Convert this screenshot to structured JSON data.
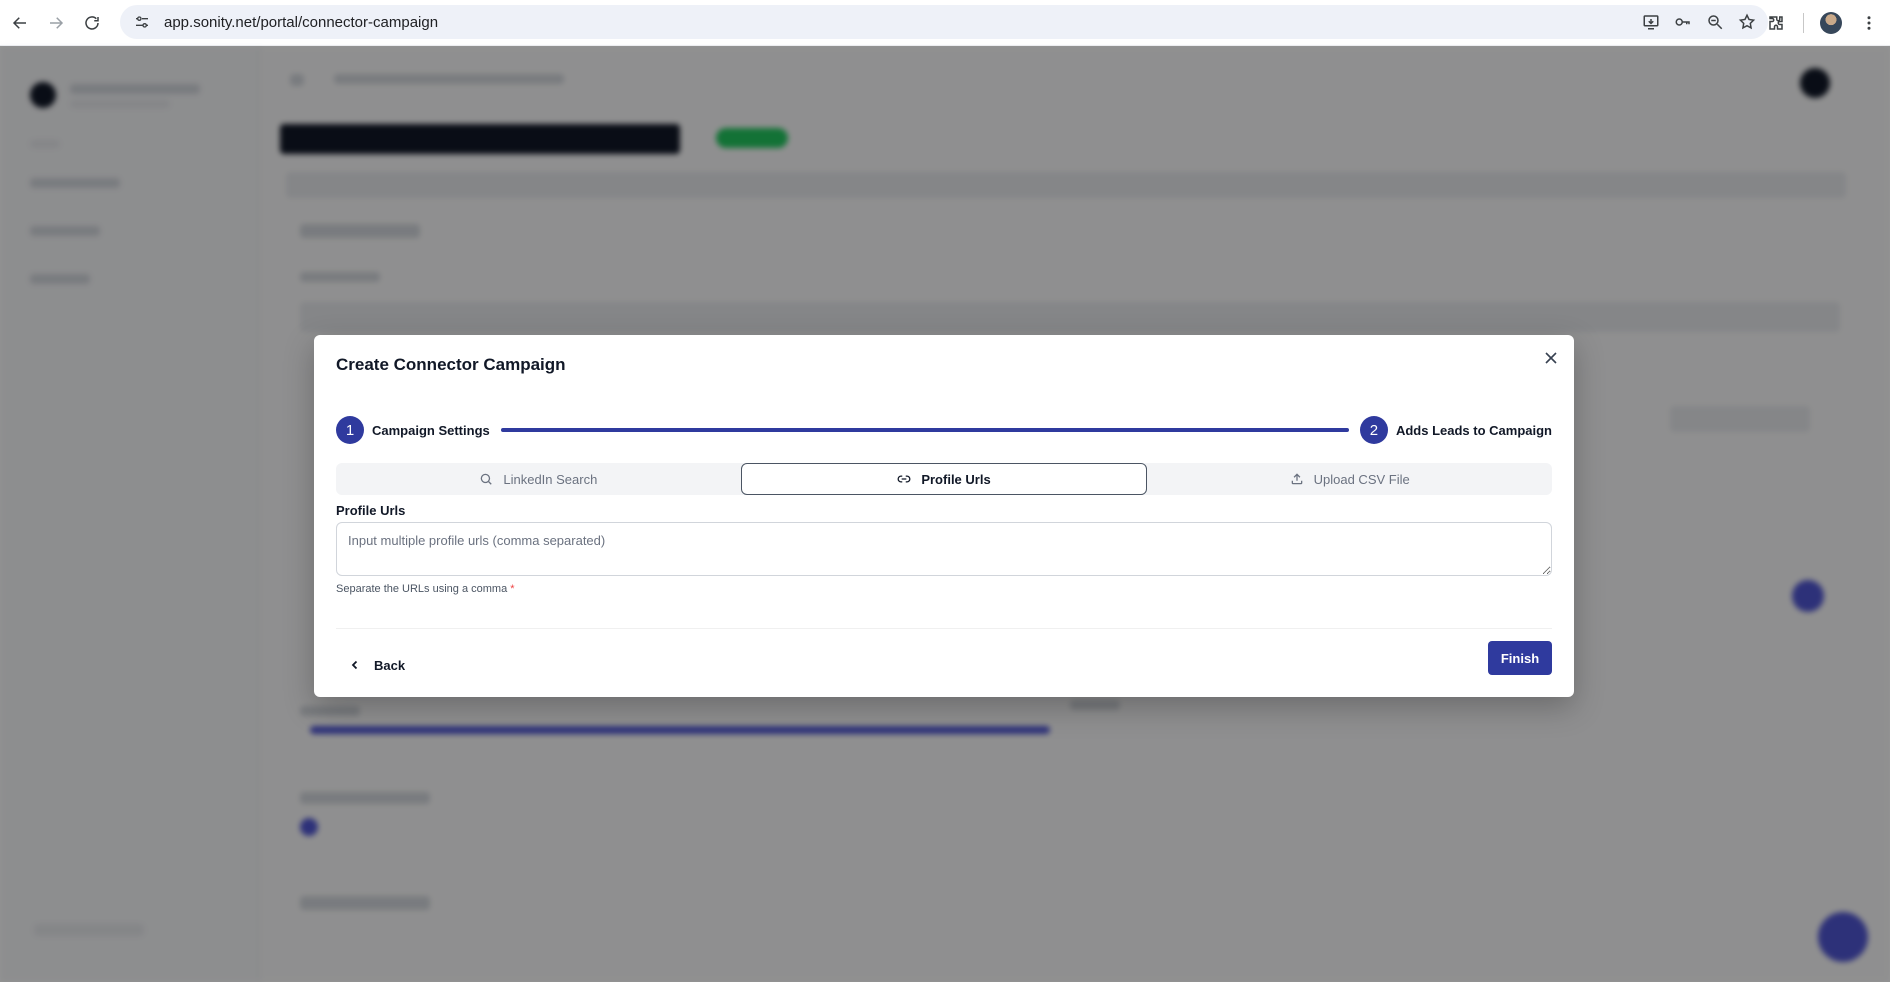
{
  "browser": {
    "url": "app.sonity.net/portal/connector-campaign"
  },
  "modal": {
    "title": "Create Connector Campaign",
    "stepper": {
      "steps": [
        {
          "number": "1",
          "label": "Campaign Settings"
        },
        {
          "number": "2",
          "label": "Adds Leads to Campaign"
        }
      ]
    },
    "tabs": [
      {
        "label": "LinkedIn Search",
        "icon": "search-icon",
        "active": false
      },
      {
        "label": "Profile Urls",
        "icon": "link-icon",
        "active": true
      },
      {
        "label": "Upload CSV File",
        "icon": "upload-icon",
        "active": false
      }
    ],
    "field": {
      "label": "Profile Urls",
      "placeholder": "Input multiple profile urls (comma separated)",
      "value": "",
      "help": "Separate the URLs using a comma",
      "required_mark": "*"
    },
    "back_label": "Back",
    "finish_label": "Finish"
  },
  "colors": {
    "primary": "#2f3a9e",
    "overlay": "rgba(0,0,0,0.42)"
  }
}
